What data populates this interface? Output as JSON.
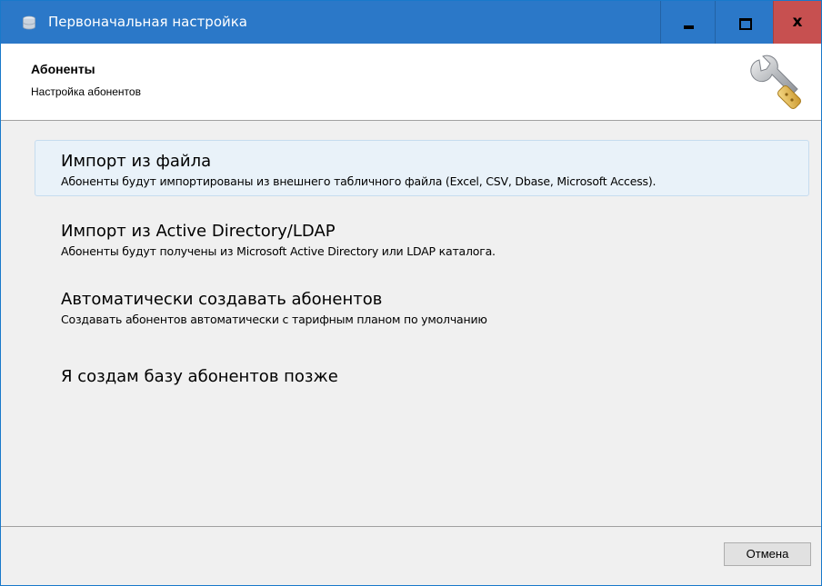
{
  "window": {
    "title": "Первоначальная настройка",
    "app_icon": "database-icon",
    "controls": {
      "minimize_icon": "minimize-icon",
      "maximize_icon": "maximize-icon",
      "close_label": "x"
    },
    "titlebar_color": "#2b78c8",
    "close_color": "#c75050"
  },
  "header": {
    "title": "Абоненты",
    "subtitle": "Настройка абонентов",
    "icon": "wrench-icon"
  },
  "options": [
    {
      "title": "Импорт из файла",
      "description": "Абоненты будут импортированы из внешнего табличного файла (Excel, CSV, Dbase, Microsoft Access).",
      "highlighted": true
    },
    {
      "title": "Импорт из Active Directory/LDAP",
      "description": "Абоненты будут получены из Microsoft Active Directory или LDAP каталога.",
      "highlighted": false
    },
    {
      "title": "Автоматически создавать абонентов",
      "description": "Создавать абонентов автоматически с тарифным планом по умолчанию",
      "highlighted": false
    },
    {
      "title": "Я создам базу абонентов позже",
      "description": "",
      "highlighted": false
    }
  ],
  "footer": {
    "cancel_label": "Отмена"
  }
}
